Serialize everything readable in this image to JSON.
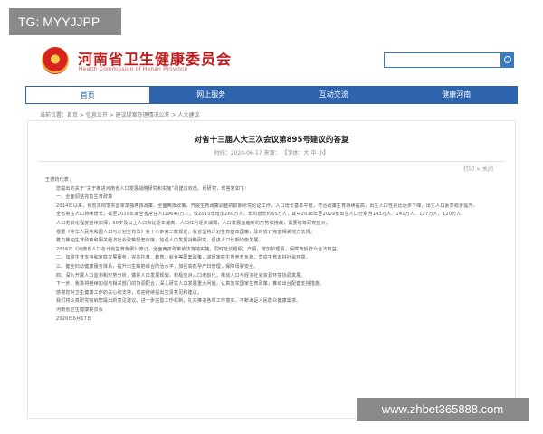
{
  "watermarks": {
    "top": "TG: MYYJJPP",
    "bottom": "www.zhbet365888.com"
  },
  "header": {
    "title": "河南省卫生健康委员会",
    "subtitle": "Health Commission of Henan Province"
  },
  "nav": [
    "首页",
    "网上服务",
    "互动交流",
    "健康河南"
  ],
  "breadcrumb": "当前位置：首页 > 信息公开 > 建议提案办理情况公开 > 人大建议",
  "article": {
    "title": "对省十三届人大三次会议第895号建议的答复",
    "meta": "时间：2020-06-17   来源：          【字体：大 中 小】",
    "tools": "打印 × 关闭",
    "paragraphs": [
      "王德钧代表：",
      "您提出的关于“关于推进河南省人口发展战略研究和实施”的建议收悉。经研究，现答复如下：",
      "一、全面调整完善生育政策",
      "2014年以来，我省贯彻落实国家单独两孩政策、全面两孩政策，开展生育政策调整的前期研究论证工作，人口增长基本平稳，符合政策生育持续提高，出生人口性别比逐步下降，出生人口素质稳步提升。",
      "全省常住人口持续增长，截至2019年底全省常住人口9640万人，较2015年增加260万人，年均增长约65万人，其中2016年至2019年出生人口分别为143万人、141万人、127万人、120万人。",
      "人口老龄化程度继续加深，60岁及以上人口占比逐年提高，人口红利逐步减弱，人口发展面临新的形势和挑战，需要统筹研究应对。",
      "根据《中华人民共和国人口与计划生育法》第十八条第二款规定，我省坚持计划生育基本国策，及时修订完善相关地方法规，",
      "着力推动生育政策和相关经济社会政策配套衔接，加强人口发展战略研究，促进人口长期均衡发展。",
      "2016年《河南省人口与计划生育条例》修订，全面两孩政策依法落地实施，同时延长婚假、产假，增加护理假，保障育龄群众合法权益。",
      "二、加强生育支持和家庭发展服务，完善托育、教育、就业等配套政策，减轻家庭生育养育负担，营造生育友好社会环境。",
      "三、健全妇幼健康服务体系，提升出生缺陷综合防治水平，加强高危孕产妇管理，保障母婴安全。",
      "四、深入开展人口监测和形势分析，做好人口发展规划，积极应对人口老龄化，推动人口与经济社会资源环境协调发展。",
      "下一步，我委将继续加强与相关部门的协调配合，深入研究人口发展重大问题，认真落实国家生育政策，推动出台配套支持措施。",
      "感谢您对卫生健康工作的关心和支持，欢迎继续提出宝贵意见和建议。",
      "我们将认真研究吸纳您提出的意见建议，进一步完善工作机制，扎实推进各项工作落实，不断满足人民群众健康需求。",
      "河南省卫生健康委员会",
      "2020年6月17日"
    ]
  }
}
